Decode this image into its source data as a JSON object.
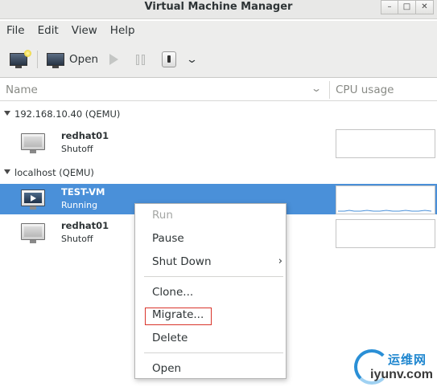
{
  "window": {
    "title": "Virtual Machine Manager",
    "buttons": [
      "–",
      "□",
      "✕"
    ]
  },
  "menubar": [
    "File",
    "Edit",
    "View",
    "Help"
  ],
  "toolbar": {
    "open_label": "Open"
  },
  "columns": {
    "name": "Name",
    "cpu": "CPU usage"
  },
  "groups": [
    {
      "label": "192.168.10.40 (QEMU)",
      "vms": [
        {
          "name": "redhat01",
          "status": "Shutoff"
        }
      ]
    },
    {
      "label": "localhost (QEMU)",
      "vms": [
        {
          "name": "TEST-VM",
          "status": "Running"
        },
        {
          "name": "redhat01",
          "status": "Shutoff"
        }
      ]
    }
  ],
  "context_menu": {
    "run": "Run",
    "pause": "Pause",
    "shutdown": "Shut Down",
    "clone": "Clone...",
    "migrate": "Migrate...",
    "delete": "Delete",
    "open": "Open"
  },
  "watermark": {
    "cn": "运维网",
    "en": "iyunv.com"
  },
  "colors": {
    "selection": "#4a90d9",
    "highlight_border": "#d9342b",
    "cpu_line": "#4a90d9"
  }
}
